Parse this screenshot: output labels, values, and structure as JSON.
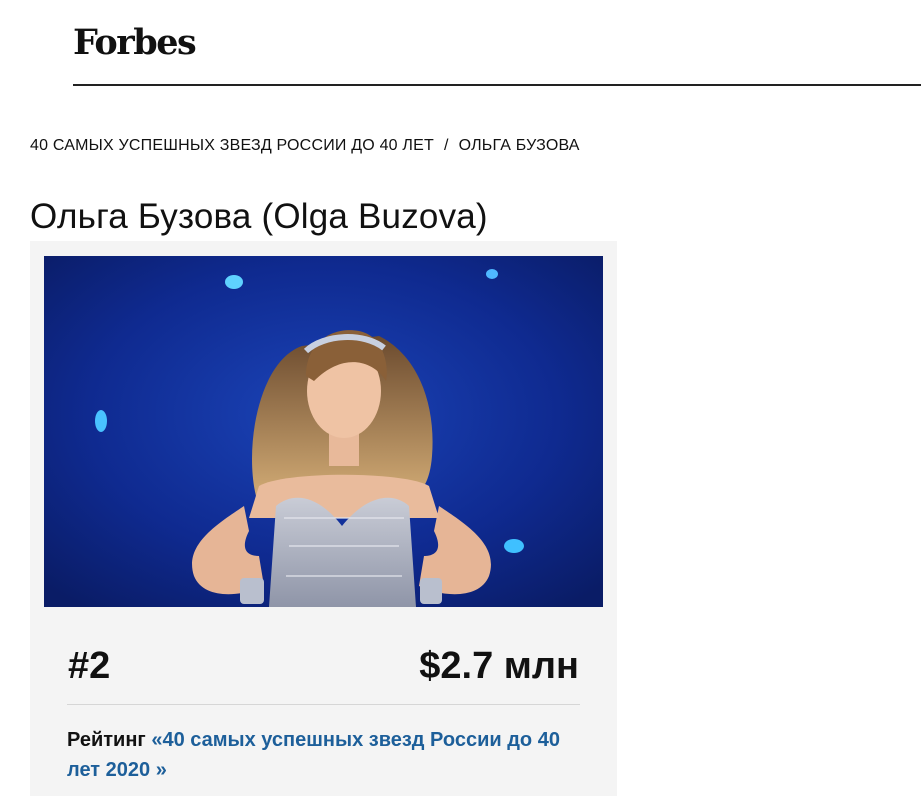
{
  "header": {
    "logo_text": "Forbes"
  },
  "breadcrumb": {
    "parent": "40 САМЫХ УСПЕШНЫХ ЗВЕЗД РОССИИ ДО 40 ЛЕТ",
    "separator": "/",
    "current": "ОЛЬГА БУЗОВА"
  },
  "profile": {
    "title": "Ольга Бузова (Olga Buzova)",
    "rank": "#2",
    "net_worth": "$2.7 млн",
    "rating_prefix": "Рейтинг",
    "rating_link": "«40 самых успешных звезд России до 40 лет 2020 »"
  },
  "colors": {
    "link": "#1d5f9a",
    "card_bg": "#f4f4f4",
    "photo_bg": "#102a8e"
  }
}
